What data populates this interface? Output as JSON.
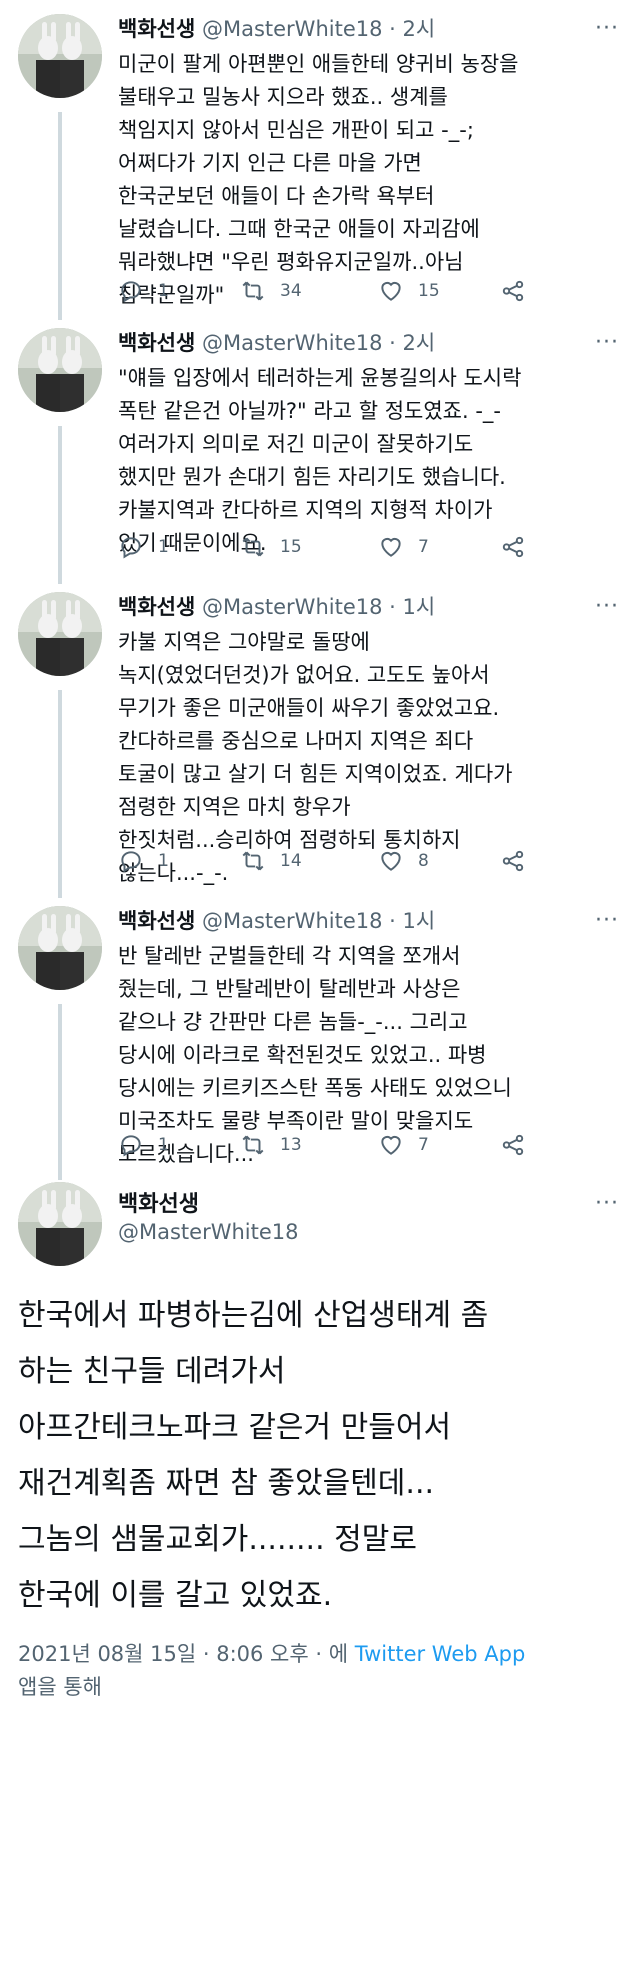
{
  "thread": {
    "tweets": [
      {
        "name": "백화선생",
        "handle": "@MasterWhite18",
        "time": "2시",
        "text": "미군이 팔게 아편뿐인 애들한테 양귀비 농장을\n불태우고 밀농사 지으라 했죠..  생계를\n책임지지 않아서 민심은 개판이 되고 -_-;\n어쩌다가 기지 인근 다른 마을 가면\n한국군보던 애들이 다 손가락 욕부터\n날렸습니다. 그때 한국군 애들이 자괴감에\n뭐라했냐면 \"우린 평화유지군일까..아님\n침략군일까\"",
        "replies": "1",
        "retweets": "34",
        "likes": "15"
      },
      {
        "name": "백화선생",
        "handle": "@MasterWhite18",
        "time": "2시",
        "text": "\"얘들 입장에서 테러하는게 윤봉길의사 도시락\n폭탄 같은건 아닐까?\" 라고 할 정도였죠. -_-\n여러가지 의미로 저긴 미군이 잘못하기도\n했지만 뭔가 손대기 힘든 자리기도 했습니다.\n카불지역과 칸다하르 지역의 지형적 차이가\n있기 때문이에요.",
        "replies": "1",
        "retweets": "15",
        "likes": "7"
      },
      {
        "name": "백화선생",
        "handle": "@MasterWhite18",
        "time": "1시",
        "text": "카불 지역은 그야말로 돌땅에\n녹지(였었더던것)가 없어요. 고도도 높아서\n무기가 좋은 미군애들이 싸우기 좋았었고요.\n칸다하르를 중심으로 나머지 지역은 죄다\n토굴이 많고 살기 더 힘든 지역이었죠. 게다가\n점령한 지역은 마치 항우가\n한짓처럼...승리하여 점령하되 통치하지\n않는다...-_-.",
        "replies": "1",
        "retweets": "14",
        "likes": "8"
      },
      {
        "name": "백화선생",
        "handle": "@MasterWhite18",
        "time": "1시",
        "text": "반 탈레반 군벌들한테 각 지역을 쪼개서\n줬는데, 그 반탈레반이 탈레반과 사상은\n같으나 걍 간판만 다른 놈들-_-... 그리고\n당시에 이라크로 확전된것도 있었고.. 파병\n당시에는 키르키즈스탄 폭동 사태도 있었으니\n미국조차도 물량 부족이란 말이 맞을지도\n모르겠습니다...",
        "replies": "1",
        "retweets": "13",
        "likes": "7"
      }
    ],
    "main": {
      "name": "백화선생",
      "handle": "@MasterWhite18",
      "text": "한국에서 파병하는김에 산업생태계 좀\n하는 친구들 데려가서\n아프간테크노파크 같은거 만들어서\n재건계획좀 짜면 참 좋았을텐데...\n그놈의 샘물교회가........ 정말로\n한국에 이를 갈고 있었죠.",
      "date": "2021년 08월 15일 · 8:06 오후 · 에",
      "via": "Twitter Web App",
      "via_suffix": "앱을 통해"
    },
    "separator": "·",
    "more_glyph": "···"
  }
}
